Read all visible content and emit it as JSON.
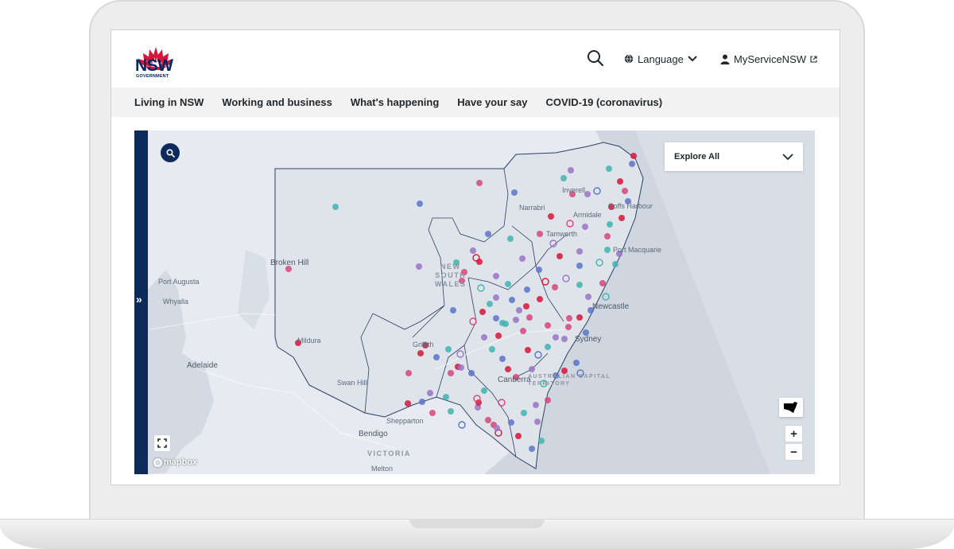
{
  "header": {
    "logo_text": "NSW",
    "logo_sub": "GOVERNMENT",
    "search_icon": "search-icon",
    "language_label": "Language",
    "account_label": "MyServiceNSW"
  },
  "nav": {
    "items": [
      {
        "label": "Living in NSW"
      },
      {
        "label": "Working and business"
      },
      {
        "label": "What's happening"
      },
      {
        "label": "Have your say"
      },
      {
        "label": "COVID-19 (coronavirus)"
      }
    ]
  },
  "map": {
    "explore_label": "Explore All",
    "zoom_in": "+",
    "zoom_out": "−",
    "attribution": "mapbox",
    "collapse_glyph": "»",
    "labels": {
      "broken_hill": "Broken Hill",
      "port_augusta": "Port Augusta",
      "whyalla": "Whyalla",
      "adelaide": "Adelaide",
      "mildura": "Mildura",
      "swan_hill": "Swan Hill",
      "shepparton": "Shepparton",
      "bendigo": "Bendigo",
      "melton": "Melton",
      "griffith": "Griffith",
      "canberra": "Canberra",
      "sydney": "Sydney",
      "newcastle": "Newcastle",
      "narrabri": "Narrabri",
      "inverell": "Inverell",
      "armidale": "Armidale",
      "tamworth": "Tamworth",
      "coffs_harbour": "Coffs Harbour",
      "port_macquarie": "Port Macquarie",
      "nsw_line1": "NEW",
      "nsw_line2": "SOUTH",
      "nsw_line3": "WALES",
      "victoria": "VICTORIA",
      "act_line1": "AUSTRALIAN CAPITAL",
      "act_line2": "TERRITORY"
    }
  },
  "colors": {
    "brand_navy": "#002664",
    "brand_red": "#d7153a",
    "marker_pink": "#d6457a",
    "marker_purple": "#9a73c4",
    "marker_teal": "#3fb4b0",
    "marker_blue": "#5a74c8"
  }
}
